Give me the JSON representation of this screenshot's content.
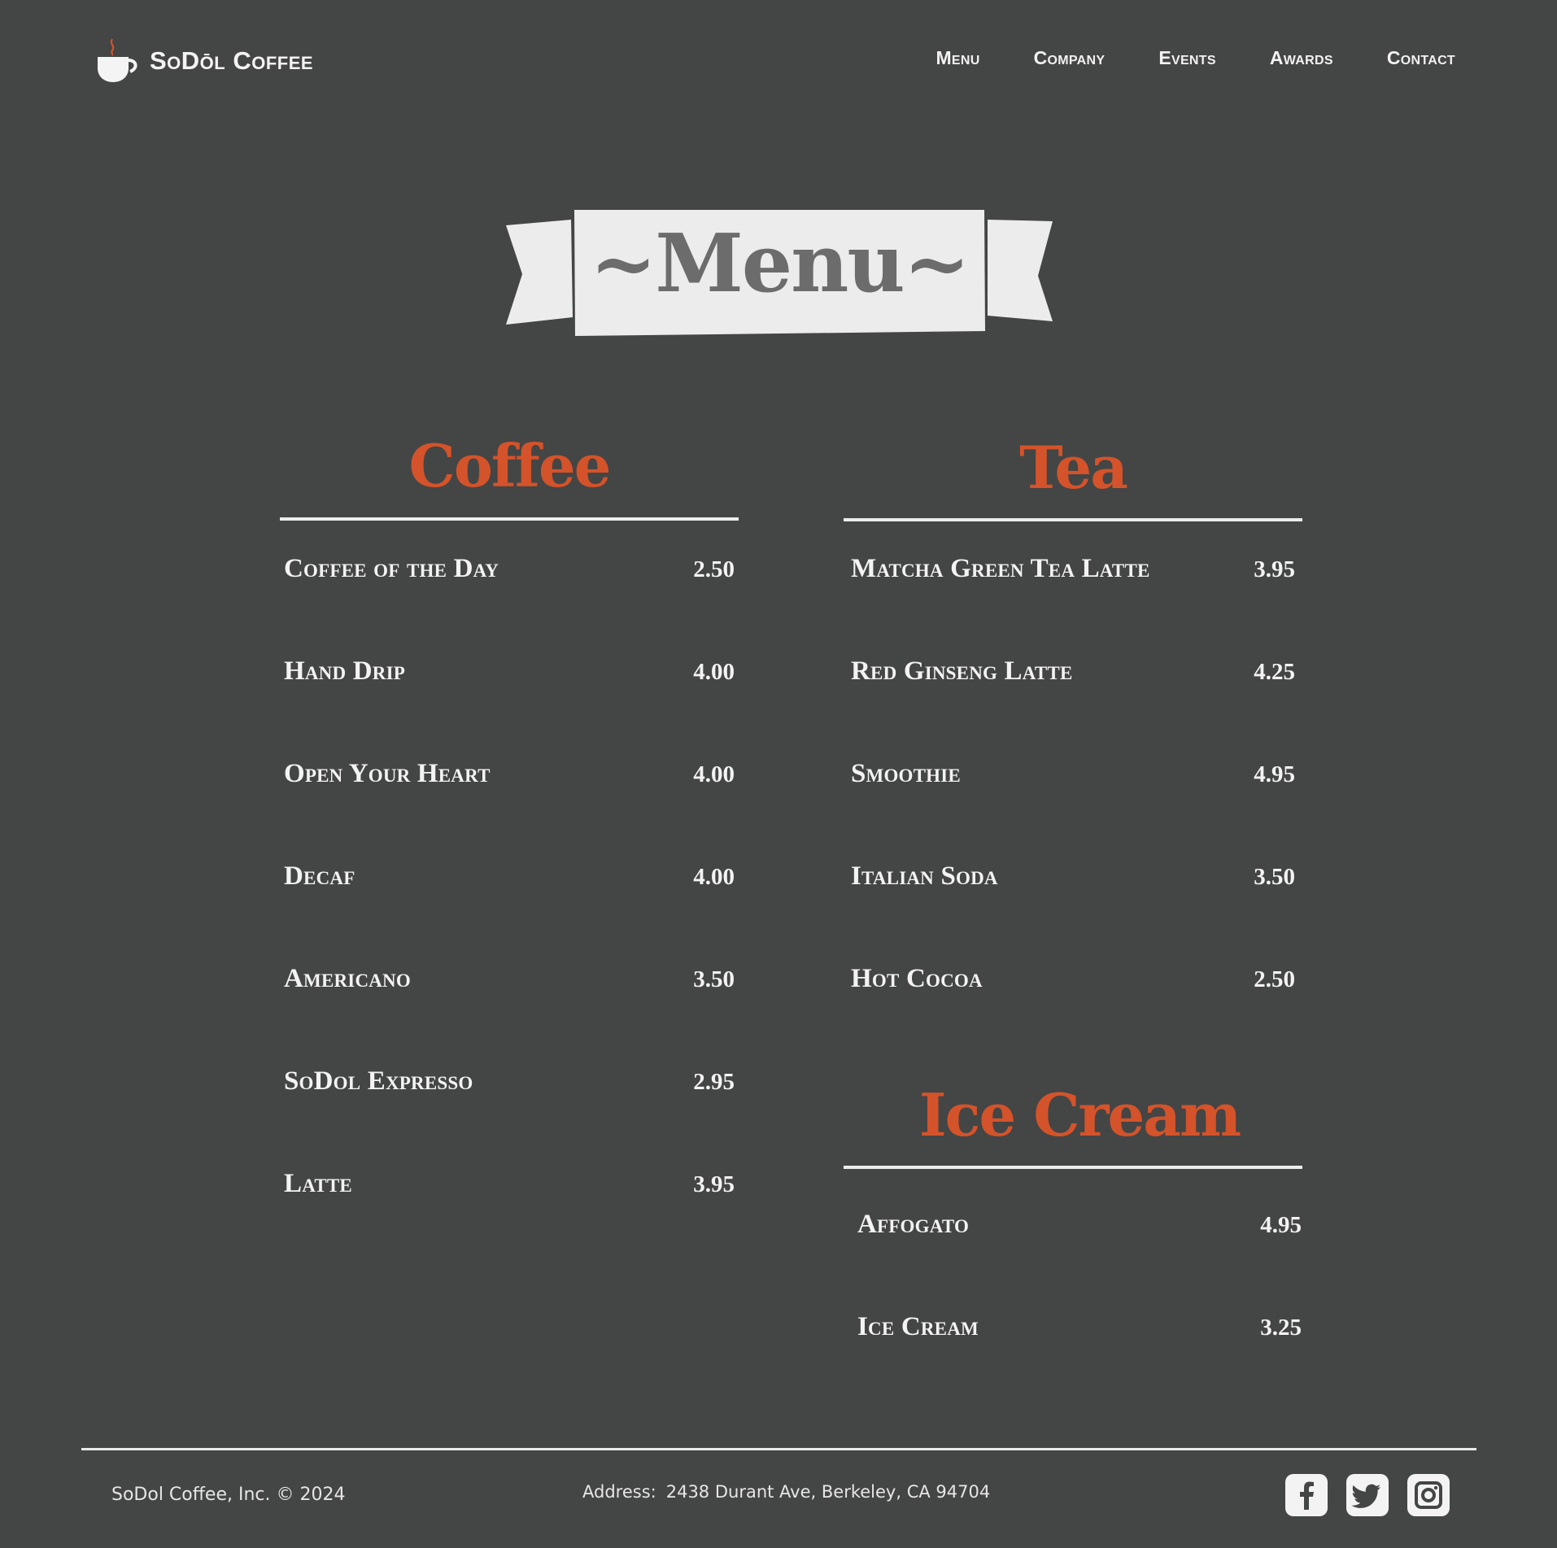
{
  "brand": {
    "name": "SoDōl Coffee",
    "icon": "coffee-cup-icon",
    "accent_color": "#d4532a"
  },
  "nav": [
    {
      "label": "Menu"
    },
    {
      "label": "Company"
    },
    {
      "label": "Events"
    },
    {
      "label": "Awards"
    },
    {
      "label": "Contact"
    }
  ],
  "banner": {
    "title": "~Menu~"
  },
  "sections": {
    "coffee": {
      "title": "Coffee",
      "items": [
        {
          "name": "Coffee of the Day",
          "price": "2.50"
        },
        {
          "name": "Hand Drip",
          "price": "4.00"
        },
        {
          "name": "Open Your Heart",
          "price": "4.00"
        },
        {
          "name": "Decaf",
          "price": "4.00"
        },
        {
          "name": "Americano",
          "price": "3.50"
        },
        {
          "name": "SoDol Expresso",
          "price": "2.95"
        },
        {
          "name": "Latte",
          "price": "3.95"
        }
      ]
    },
    "tea": {
      "title": "Tea",
      "items": [
        {
          "name": "Matcha Green Tea Latte",
          "price": "3.95"
        },
        {
          "name": "Red Ginseng Latte",
          "price": "4.25"
        },
        {
          "name": "Smoothie",
          "price": "4.95"
        },
        {
          "name": "Italian Soda",
          "price": "3.50"
        },
        {
          "name": "Hot Cocoa",
          "price": "2.50"
        }
      ]
    },
    "ice_cream": {
      "title": "Ice Cream",
      "items": [
        {
          "name": "Affogato",
          "price": "4.95"
        },
        {
          "name": "Ice Cream",
          "price": "3.25"
        }
      ]
    }
  },
  "footer": {
    "copyright": "SoDol Coffee, Inc. © 2024",
    "address_label": "Address:",
    "address_value": "2438 Durant Ave, Berkeley, CA 94704",
    "social": [
      {
        "icon": "facebook-icon"
      },
      {
        "icon": "twitter-icon"
      },
      {
        "icon": "instagram-icon"
      }
    ]
  },
  "colors": {
    "background": "#444545",
    "section_title": "#d4532a",
    "text": "#f3f3f3",
    "banner_fill": "#ececec"
  }
}
